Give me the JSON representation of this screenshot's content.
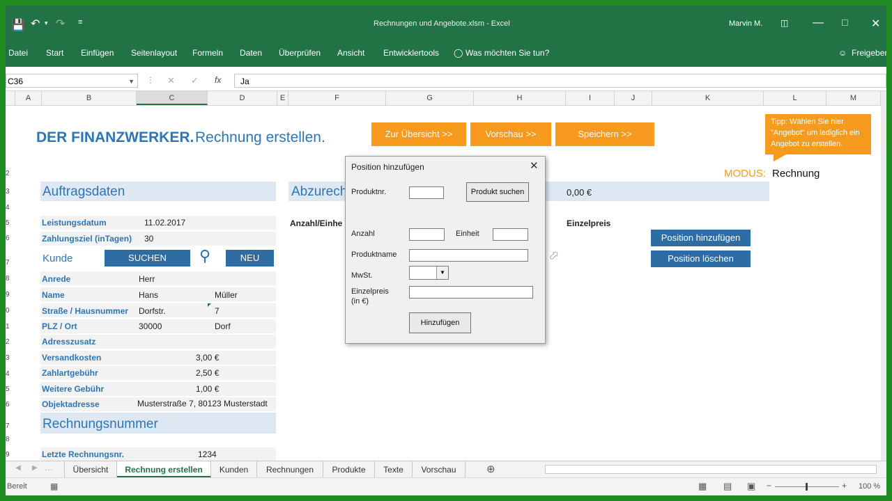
{
  "window": {
    "title": "Rechnungen und Angebote.xlsm  -  Excel",
    "user": "Marvin M."
  },
  "ribbon": {
    "tabs": [
      "Datei",
      "Start",
      "Einfügen",
      "Seitenlayout",
      "Formeln",
      "Daten",
      "Überprüfen",
      "Ansicht",
      "Entwicklertools"
    ],
    "tell_me": "Was möchten Sie tun?",
    "share": "Freigeben"
  },
  "formula_bar": {
    "name_box": "C36",
    "fx": "fx",
    "value": "Ja"
  },
  "columns": [
    "A",
    "B",
    "C",
    "D",
    "E",
    "F",
    "G",
    "H",
    "I",
    "J",
    "K",
    "L",
    "M"
  ],
  "header": {
    "brand": "DER FINANZWERKER.",
    "subtitle": "Rechnung erstellen."
  },
  "nav_buttons": {
    "overview": "Zur Übersicht >>",
    "preview": "Vorschau >>",
    "save": "Speichern >>"
  },
  "tip": "Tipp: Wählen Sie hier \"Angebot\" um lediglich ein Angebot zu erstellen.",
  "modus": {
    "label": "MODUS:",
    "value": "Rechnung"
  },
  "row_numbers": [
    "2",
    "3",
    "4",
    "5",
    "6",
    "7",
    "8",
    "9",
    "0",
    "1",
    "2",
    "3",
    "4",
    "5",
    "6",
    "7",
    "8",
    "9"
  ],
  "auftragsdaten": {
    "title": "Auftragsdaten",
    "leistungsdatum_label": "Leistungsdatum",
    "leistungsdatum": "11.02.2017",
    "zahlungsziel_label": "Zahlungsziel (inTagen)",
    "zahlungsziel": "30"
  },
  "kunde": {
    "title": "Kunde",
    "search_btn": "SUCHEN",
    "new_btn": "NEU",
    "anrede_label": "Anrede",
    "anrede": "Herr",
    "name_label": "Name",
    "vorname": "Hans",
    "nachname": "Müller",
    "strasse_label": "Straße / Hausnummer",
    "strasse": "Dorfstr.",
    "hausnummer": "7",
    "plz_label": "PLZ / Ort",
    "plz": "30000",
    "ort": "Dorf",
    "adresszusatz_label": "Adresszusatz",
    "versand_label": "Versandkosten",
    "versand": "3,00 €",
    "zahlart_label": "Zahlartgebühr",
    "zahlart": "2,50 €",
    "weitere_label": "Weitere Gebühr",
    "weitere": "1,00 €",
    "objekt_label": "Objektadresse",
    "objekt": "Musterstraße 7, 80123 Musterstadt"
  },
  "rechnungsnummer": {
    "title": "Rechnungsnummer",
    "letzte_label": "Letzte Rechnungsnr.",
    "letzte": "1234"
  },
  "abzurechnen": {
    "title": "Abzurech",
    "amount": "0,00 €",
    "anzahl_header": "Anzahl/Einhe",
    "einzelpreis_header": "Einzelpreis",
    "add_btn": "Position hinzufügen",
    "delete_btn": "Position löschen"
  },
  "dialog": {
    "title": "Position hinzufügen",
    "produktnr_label": "Produktnr.",
    "produkt_suchen": "Produkt suchen",
    "anzahl_label": "Anzahl",
    "einheit_label": "Einheit",
    "produktname_label": "Produktname",
    "mwst_label": "MwSt.",
    "einzelpreis_label": "Einzelpreis",
    "einzelpreis_unit": "(in €)",
    "add_btn": "Hinzufügen"
  },
  "sheet_tabs": [
    "Übersicht",
    "Rechnung erstellen",
    "Kunden",
    "Rechnungen",
    "Produkte",
    "Texte",
    "Vorschau"
  ],
  "status": {
    "left": "Bereit",
    "zoom": "100 %"
  },
  "colors": {
    "excel_green": "#217346",
    "orange": "#f79a1e",
    "blue": "#2e75b6",
    "button_blue": "#2e6da4"
  }
}
